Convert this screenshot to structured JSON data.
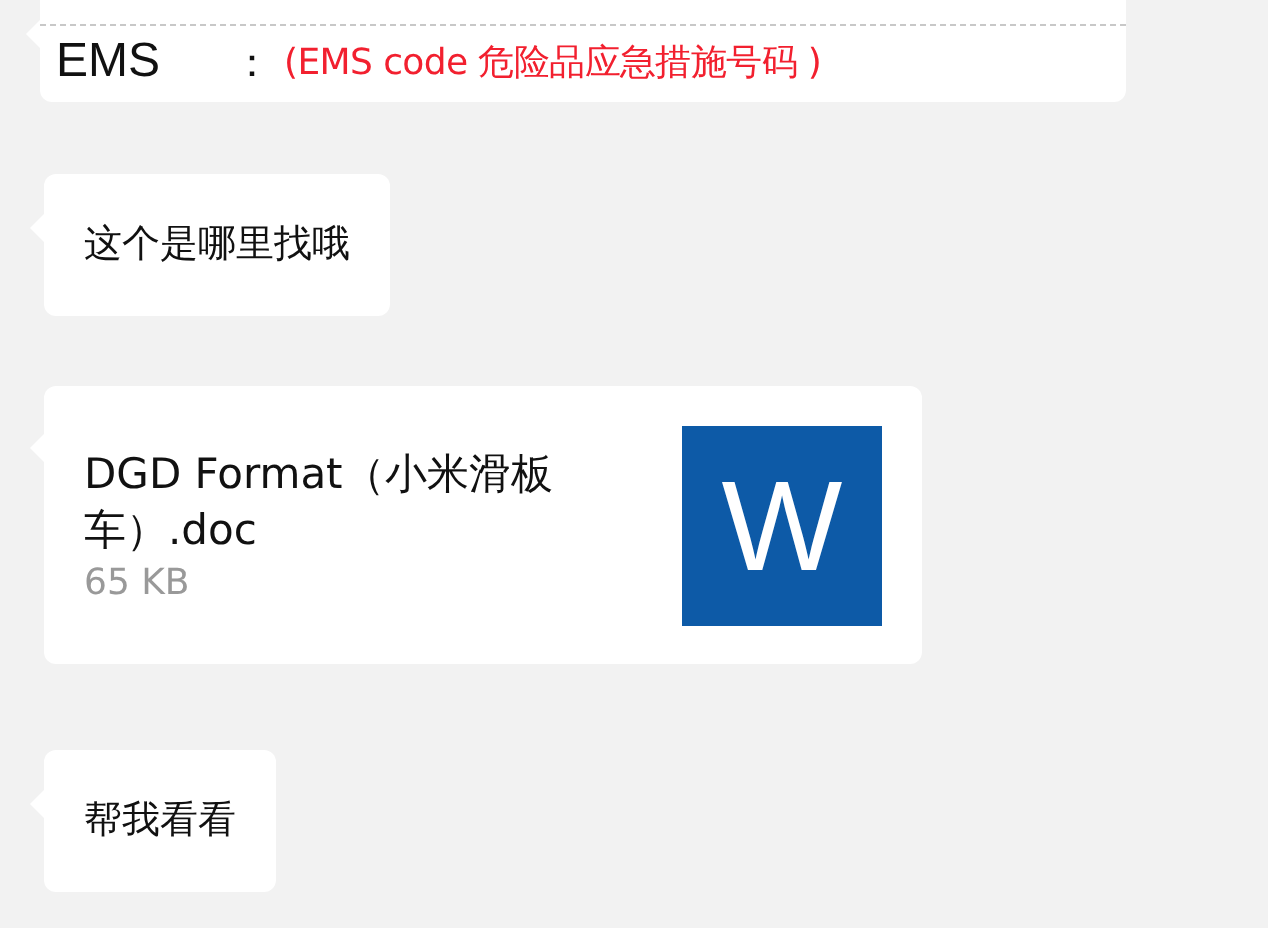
{
  "messages": [
    {
      "kind": "document",
      "label": "EMS",
      "separator": "：",
      "note": "(EMS code 危险品应急措施号码 )"
    },
    {
      "kind": "text",
      "text": "这个是哪里找哦"
    },
    {
      "kind": "file",
      "name": "DGD Format（小米滑板车）.doc",
      "size": "65 KB",
      "icon_letter": "W"
    },
    {
      "kind": "text",
      "text": "帮我看看"
    }
  ]
}
